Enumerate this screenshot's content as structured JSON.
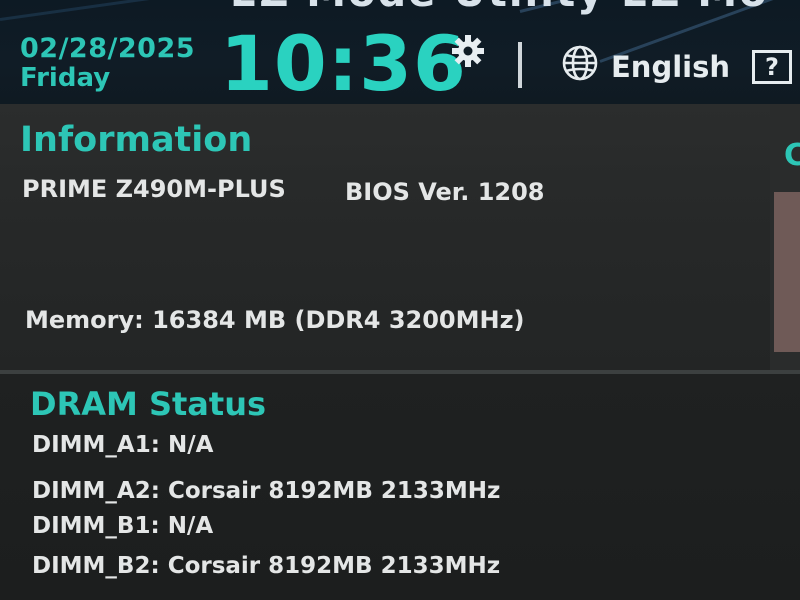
{
  "header": {
    "title": "EZ Mode Utility   EZ Mo",
    "date": "02/28/2025",
    "day": "Friday",
    "time": "10:36",
    "settings_icon": "gear-icon",
    "language_icon": "globe-icon",
    "language": "English",
    "help_label": "?",
    "accent_color": "#2dc6b6"
  },
  "information": {
    "title": "Information",
    "board": "PRIME Z490M-PLUS",
    "bios": "BIOS Ver. 1208",
    "memory_label": "Memory:",
    "memory_value": "16384 MB (DDR4 3200MHz)"
  },
  "side_panel": {
    "partial_title": "C"
  },
  "dram": {
    "title": "DRAM Status",
    "slots": [
      {
        "label": "DIMM_A1:",
        "value": "N/A"
      },
      {
        "label": "DIMM_A2:",
        "value": "Corsair 8192MB 2133MHz"
      },
      {
        "label": "DIMM_B1:",
        "value": "N/A"
      },
      {
        "label": "DIMM_B2:",
        "value": "Corsair 8192MB 2133MHz"
      }
    ]
  }
}
